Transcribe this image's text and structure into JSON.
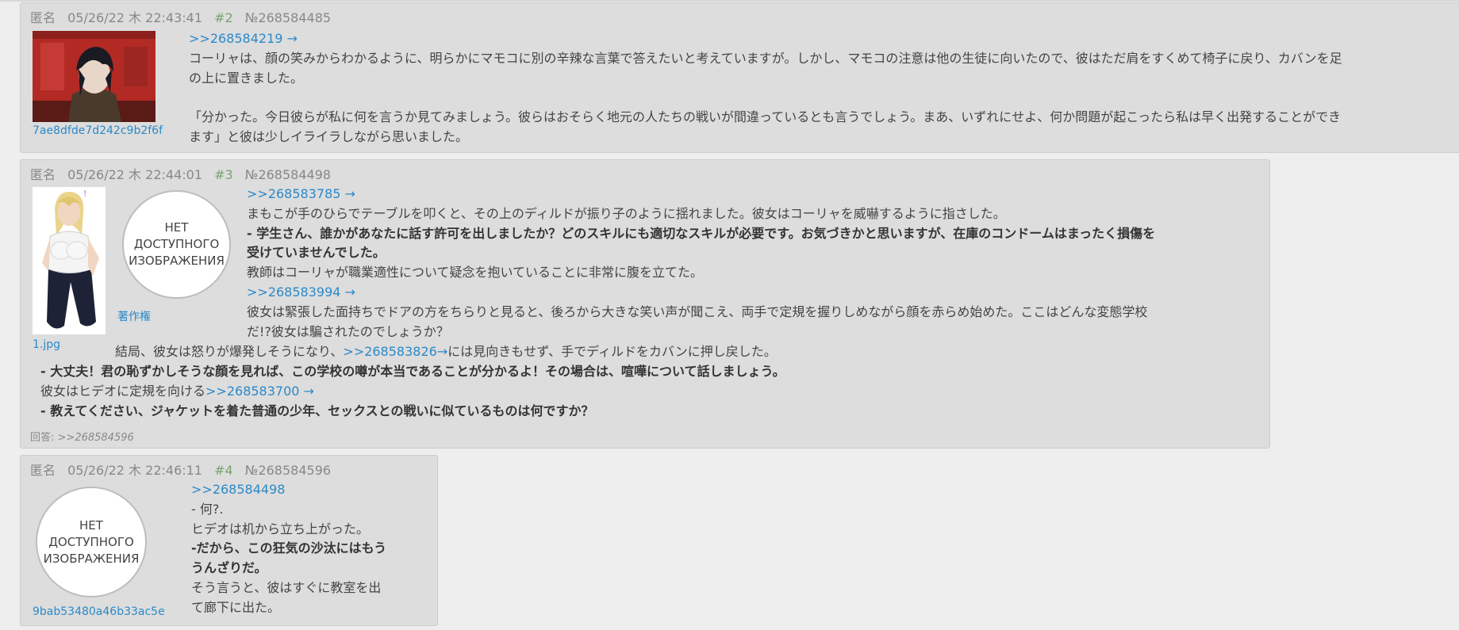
{
  "posts": [
    {
      "meta": {
        "name": "匿名",
        "date": "05/26/22 木 22:43:41",
        "index": "#2",
        "number": "№268584485"
      },
      "file_caption": "7ae8dfde7d242c9b2f6fdc4...",
      "lines": [
        {
          "link": ">>268584219",
          "arrow": "→"
        },
        {
          "text": "コーリャは、顔の笑みからわかるように、明らかにマモコに別の辛辣な言葉で答えたいと考えていますが。しかし、マモコの注意は他の生徒に向いたので、彼はただ肩をすくめて椅子に戻り、カバンを足"
        },
        {
          "text": "の上に置きました。"
        },
        {
          "text": ""
        },
        {
          "text": "「分かった。今日彼らが私に何を言うか見てみましょう。彼らはおそらく地元の人たちの戦いが間違っているとも言うでしょう。まあ、いずれにせよ、何か問題が起こったら私は早く出発することができ"
        },
        {
          "text": "ます」と彼は少しイライラしながら思いました。"
        }
      ]
    },
    {
      "meta": {
        "name": "匿名",
        "date": "05/26/22 木 22:44:01",
        "index": "#3",
        "number": "№268584498"
      },
      "file_caption": "1.jpg",
      "noimage_lines": [
        "НЕТ",
        "ДОСТУПНОГО",
        "ИЗОБРАЖЕНИЯ"
      ],
      "copyright": "著作権",
      "lines": [
        {
          "link": ">>268583785",
          "arrow": "→"
        },
        {
          "text": "まもこが手のひらでテーブルを叩くと、その上のディルドが振り子のように揺れました。彼女はコーリャを威嚇するように指さした。"
        },
        {
          "text": "- 学生さん、誰かがあなたに話す許可を出しましたか？どのスキルにも適切なスキルが必要です。お気づきかと思いますが、在庫のコンドームはまったく損傷を",
          "bold": true
        },
        {
          "text": "受けていませんでした。",
          "bold": true
        },
        {
          "text": "教師はコーリャが職業適性について疑念を抱いていることに非常に腹を立てた。"
        },
        {
          "link": ">>268583994",
          "arrow": "→"
        },
        {
          "text": "彼女は緊張した面持ちでドアの方をちらりと見ると、後ろから大きな笑い声が聞こえ、両手で定規を握りしめながら顔を赤らめ始めた。ここはどんな変態学校"
        },
        {
          "text": "だ!?彼女は騙されたのでしょうか？"
        }
      ],
      "wide_line": {
        "pre": "結局、彼女は怒りが爆発しそうになり、",
        "link": ">>268583826",
        "arrow": "→",
        "post": "には見向きもせず、手でディルドをカバンに押し戻した。"
      },
      "bottom_lines": [
        {
          "text": "- 大丈夫！君の恥ずかしそうな顔を見れば、この学校の噂が本当であることが分かるよ！その場合は、喧嘩について話しましょう。",
          "bold": true
        },
        {
          "pre": "彼女はヒデオに定規を向ける",
          "link": ">>268583700",
          "arrow": "→"
        },
        {
          "text": "- 教えてください、ジャケットを着た普通の少年、セックスとの戦いに似ているものは何ですか？",
          "bold": true
        }
      ],
      "replies_label": "回答:",
      "replies_link": ">>268584596"
    },
    {
      "meta": {
        "name": "匿名",
        "date": "05/26/22 木 22:46:11",
        "index": "#4",
        "number": "№268584596"
      },
      "file_caption": "9bab53480a46b33ac5ebd4...",
      "noimage_lines": [
        "НЕТ",
        "ДОСТУПНОГО",
        "ИЗОБРАЖЕНИЯ"
      ],
      "lines": [
        {
          "link": ">>268584498"
        },
        {
          "text": "- 何?."
        },
        {
          "text": "ヒデオは机から立ち上がった。"
        },
        {
          "text": "-だから、この狂気の沙汰にはもう",
          "bold": true
        },
        {
          "text": "うんざりだ。",
          "bold": true
        },
        {
          "text": "そう言うと、彼はすぐに教室を出"
        },
        {
          "text": "て廊下に出た。"
        }
      ]
    }
  ]
}
